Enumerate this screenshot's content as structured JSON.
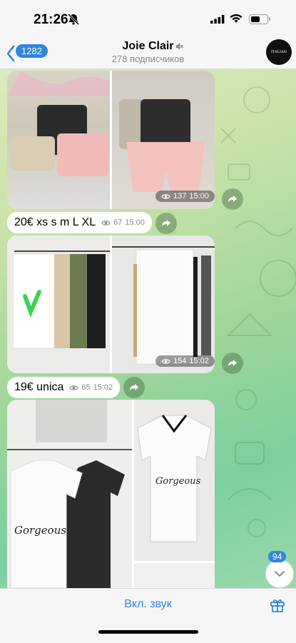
{
  "status_bar": {
    "time": "21:26"
  },
  "header": {
    "back_count": "1282",
    "title": "Joie Clair",
    "subtitle": "278 подписчиков",
    "avatar_text": "ITALIAN STYLE"
  },
  "messages": [
    {
      "type": "album",
      "views": "137",
      "time": "15:00"
    },
    {
      "type": "text",
      "text": "20€ xs s m L XL",
      "views": "67",
      "time": "15:00"
    },
    {
      "type": "album",
      "views": "154",
      "time": "15:02"
    },
    {
      "type": "text",
      "text": "19€ unica",
      "views": "65",
      "time": "15:02"
    },
    {
      "type": "album"
    }
  ],
  "photos": {
    "m1_left": "shorts-stack",
    "m1_right": "pink-shorts",
    "m3_left": "trousers-rack",
    "m3_right": "white-trousers",
    "m5_left": "gorgeous-tshirts",
    "m5_right": "gorgeous-tshirt"
  },
  "scroll_down": {
    "unread": "94"
  },
  "bottom_bar": {
    "sound_label": "Вкл. звук"
  },
  "colors": {
    "accent": "#2e86de",
    "bubble": "#ffffff"
  },
  "icons": [
    "chevron-left-icon",
    "bell-muted-icon",
    "signal-icon",
    "wifi-icon",
    "battery-icon",
    "mute-icon",
    "eye-icon",
    "share-icon",
    "chevron-down-icon",
    "gift-icon"
  ]
}
